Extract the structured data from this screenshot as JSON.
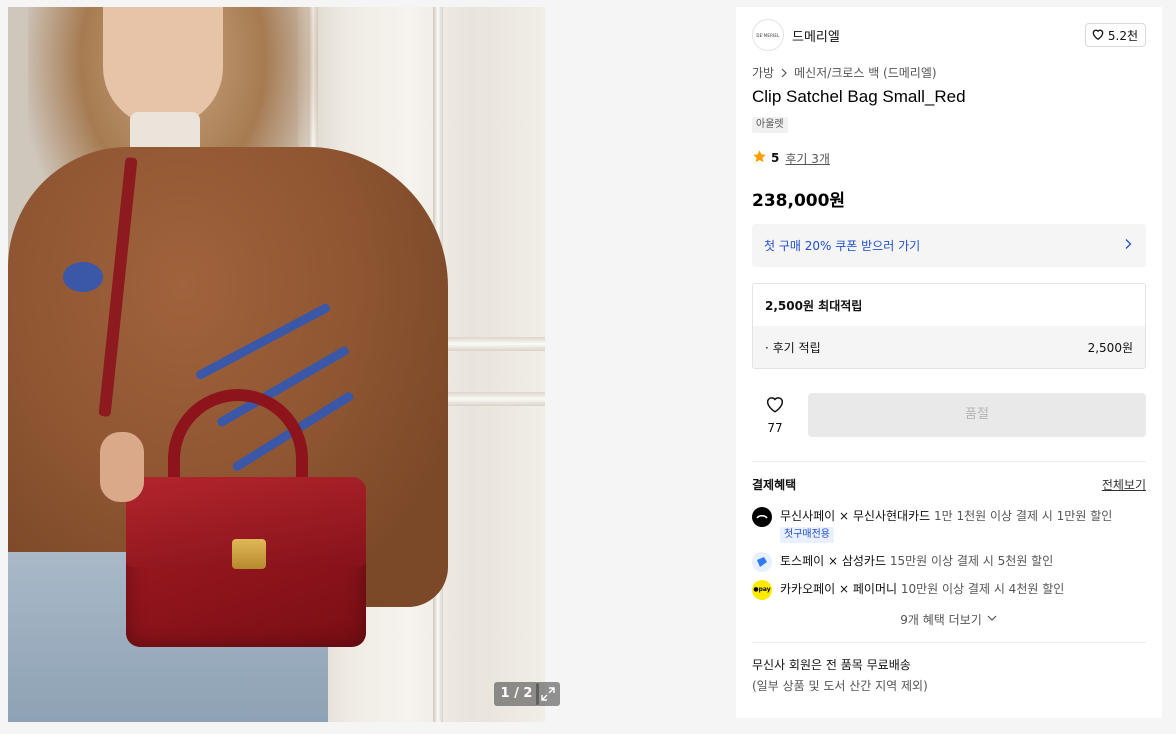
{
  "gallery": {
    "counter": "1 / 2",
    "expand_icon": "expand-icon"
  },
  "brand": {
    "logo_text": "DE'MERIEL",
    "name": "드메리엘",
    "likes": "5.2천"
  },
  "breadcrumb": {
    "category": "가방",
    "subcategory": "메신저/크로스 백 (드메리엘)"
  },
  "product": {
    "title": "Clip Satchel Bag Small_Red",
    "tag": "아울렛",
    "rating": "5",
    "reviews": "후기 3개",
    "price": "238,000원"
  },
  "coupon": {
    "text": "첫 구매 20% 쿠폰 받으러 가기"
  },
  "points": {
    "header": "2,500원 최대적립",
    "row_label": "· 후기 적립",
    "row_value": "2,500원"
  },
  "actions": {
    "wish_count": "77",
    "soldout_label": "품절"
  },
  "benefits": {
    "title": "결제혜택",
    "view_all": "전체보기",
    "items": [
      {
        "name": "무신사페이 × 무신사현대카드",
        "desc": "1만 1천원 이상 결제 시 1만원 할인",
        "badge": "첫구매전용",
        "icon": "musinsa-pay-icon",
        "color": "#000000"
      },
      {
        "name": "토스페이 × 삼성카드",
        "desc": "15만원 이상 결제 시 5천원 할인",
        "icon": "toss-pay-icon",
        "color": "#e8f0fe"
      },
      {
        "name": "카카오페이 × 페이머니",
        "desc": "10만원 이상 결제 시 4천원 할인",
        "icon": "kakao-pay-icon",
        "color": "#ffeb00",
        "icon_text": "●pay"
      }
    ],
    "more": "9개 혜택 더보기"
  },
  "shipping": {
    "line1": "무신사 회원은 전 품목 무료배송",
    "line2": "(일부 상품 및 도서 산간 지역 제외)"
  },
  "colors": {
    "accent_blue": "#1f4fd0",
    "star": "#ff9e00",
    "soldout_bg": "#e9e9e9"
  }
}
